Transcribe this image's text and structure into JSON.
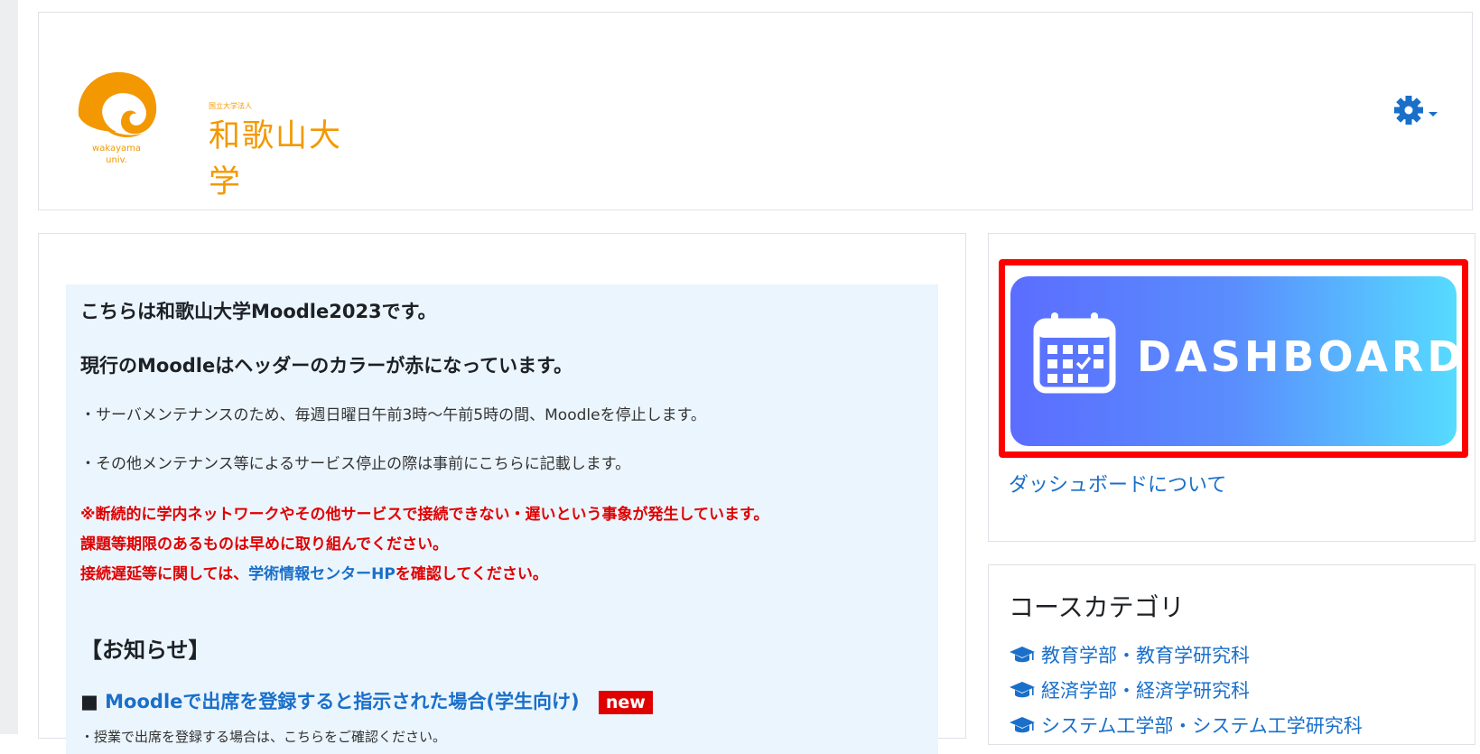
{
  "header": {
    "logo_small_text": "国立大学法人",
    "logo_name": "和歌山大学",
    "logo_sub_line1": "wakayama",
    "logo_sub_line2": "univ.",
    "brand_color": "#f39800",
    "settings_icon": "gear-icon"
  },
  "notice": {
    "title1": "こちらは和歌山大学Moodle2023です。",
    "title2": "現行のMoodleはヘッダーのカラーが赤になっています。",
    "line1": "・サーバメンテナンスのため、毎週日曜日午前3時～午前5時の間、Moodleを停止します。",
    "line2": "・その他メンテナンス等によるサービス停止の際は事前にこちらに記載します。",
    "red1": "※断続的に学内ネットワークやその他サービスで接続できない・遅いという事象が発生しています。",
    "red2": "課題等期限のあるものは早めに取り組んでください。",
    "red3_prefix": "接続遅延等に関しては、",
    "red3_link": "学術情報センターHP",
    "red3_suffix": "を確認してください。",
    "section_title": "【お知らせ】",
    "item_square": "■",
    "item_link": "Moodleで出席を登録すると指示された場合(学生向け)",
    "item_badge": "new",
    "item_sub": "・授業で出席を登録する場合は、こちらをご確認ください。"
  },
  "dashboard": {
    "button_label": "DASHBOARD",
    "about_link": "ダッシュボードについて",
    "icon": "calendar-icon"
  },
  "categories": {
    "title": "コースカテゴリ",
    "items": [
      "教育学部・教育学研究科",
      "経済学部・経済学研究科",
      "システム工学部・システム工学研究科"
    ]
  },
  "colors": {
    "link": "#1a6fc9",
    "alert_red": "#e00000",
    "notice_bg": "#ebf5fd",
    "highlight": "#ff0000"
  }
}
